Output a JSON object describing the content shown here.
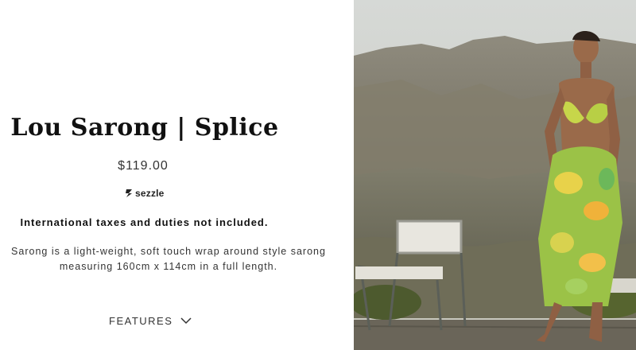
{
  "product": {
    "title": "Lou Sarong | Splice",
    "price": "$119.00",
    "payment_provider": "sezzle",
    "tax_notice": "International taxes and duties not included.",
    "description_lines": [
      "Sarong is a light-weight, soft touch wrap around style sarong",
      "measuring 160cm x 114cm in a full length."
    ],
    "features_label": "FEATURES"
  },
  "icons": {
    "sezzle_logo": "sezzle-logo-icon",
    "features_toggle": "chevron-down-icon"
  },
  "colors": {
    "text": "#111111",
    "background": "#ffffff"
  }
}
